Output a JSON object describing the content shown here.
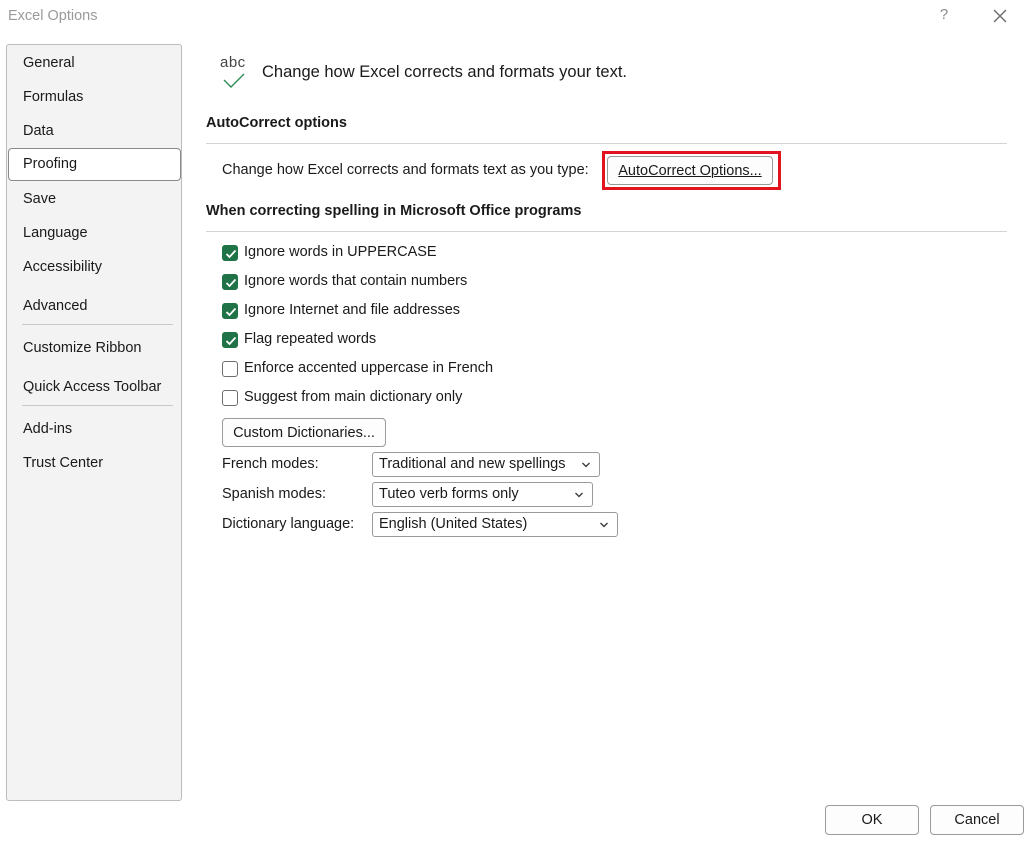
{
  "window": {
    "title": "Excel Options",
    "help_glyph": "?"
  },
  "sidebar": {
    "items": [
      {
        "label": "General"
      },
      {
        "label": "Formulas"
      },
      {
        "label": "Data"
      },
      {
        "label": "Proofing",
        "selected": true
      },
      {
        "label": "Save"
      },
      {
        "label": "Language"
      },
      {
        "label": "Accessibility"
      },
      {
        "label": "Advanced"
      },
      {
        "label": "Customize Ribbon"
      },
      {
        "label": "Quick Access Toolbar"
      },
      {
        "label": "Add-ins"
      },
      {
        "label": "Trust Center"
      }
    ]
  },
  "header": {
    "icon": "abc-check-icon",
    "icon_text": "abc",
    "text": "Change how Excel corrects and formats your text."
  },
  "autocorrect": {
    "section_title": "AutoCorrect options",
    "description": "Change how Excel corrects and formats text as you type:",
    "button_label": "AutoCorrect Options..."
  },
  "spelling": {
    "section_title": "When correcting spelling in Microsoft Office programs",
    "options": [
      {
        "label": "Ignore words in UPPERCASE",
        "checked": true
      },
      {
        "label": "Ignore words that contain numbers",
        "checked": true
      },
      {
        "label": "Ignore Internet and file addresses",
        "checked": true
      },
      {
        "label": "Flag repeated words",
        "checked": true
      },
      {
        "label": "Enforce accented uppercase in French",
        "checked": false
      },
      {
        "label": "Suggest from main dictionary only",
        "checked": false
      }
    ],
    "custom_dictionaries_label": "Custom Dictionaries...",
    "french_modes": {
      "label": "French modes:",
      "value": "Traditional and new spellings"
    },
    "spanish_modes": {
      "label": "Spanish modes:",
      "value": "Tuteo verb forms only"
    },
    "dictionary_language": {
      "label": "Dictionary language:",
      "value": "English (United States)"
    }
  },
  "footer": {
    "ok_label": "OK",
    "cancel_label": "Cancel"
  },
  "colors": {
    "check_green": "#1f7346",
    "highlight_red": "#e0131f"
  }
}
